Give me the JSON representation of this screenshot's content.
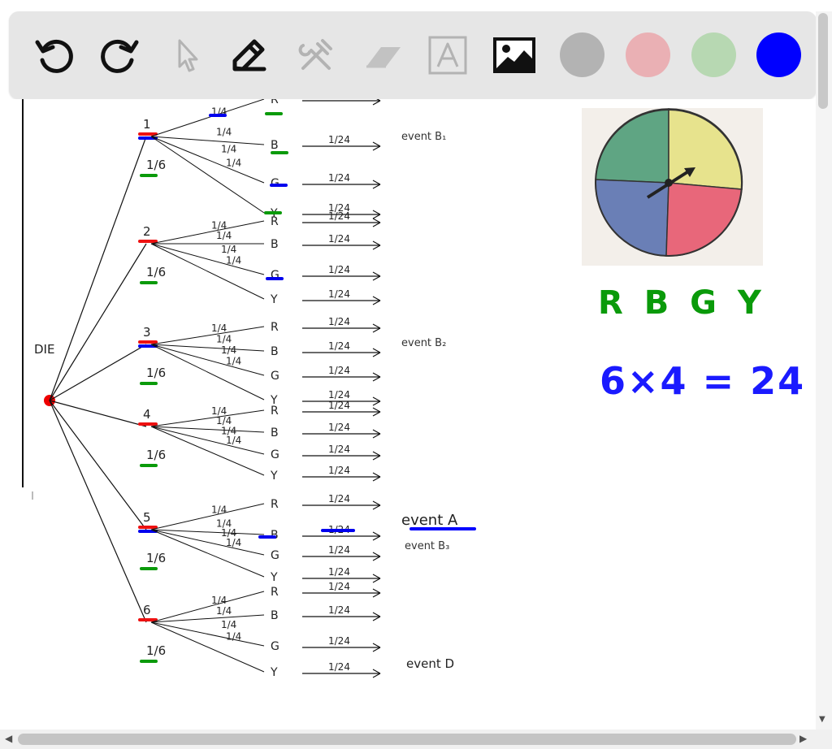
{
  "toolbar": {
    "tools": [
      "undo-icon",
      "redo-icon",
      "select-pointer-icon",
      "pen-icon",
      "tools-icon",
      "eraser-icon",
      "text-icon",
      "image-icon"
    ],
    "colors": [
      "#b3b3b3",
      "#eab0b4",
      "#b7d8b2",
      "#0000ff"
    ]
  },
  "canvas": {
    "tree": {
      "root_label": "DIE",
      "die_faces": [
        {
          "face": "1",
          "prob": "1/6"
        },
        {
          "face": "2",
          "prob": "1/6"
        },
        {
          "face": "3",
          "prob": "1/6"
        },
        {
          "face": "4",
          "prob": "1/6"
        },
        {
          "face": "5",
          "prob": "1/6"
        },
        {
          "face": "6",
          "prob": "1/6"
        }
      ],
      "branch_prob": "1/4",
      "outcome_prob": "1/24",
      "spinner_outcomes": [
        "R",
        "B",
        "G",
        "Y"
      ],
      "event_b1": "event B₁",
      "event_b2": "event B₂",
      "event_a": "event A",
      "event_b3": "event B₃",
      "event_d": "event D"
    },
    "spinner": {
      "colors": {
        "green": "#5fa583",
        "yellow": "#e7e38d",
        "blue": "#6a7fb6",
        "red": "#e8677a"
      }
    },
    "notes": {
      "colors_line": "R B G Y",
      "count_line": "6×4 = 24"
    }
  }
}
